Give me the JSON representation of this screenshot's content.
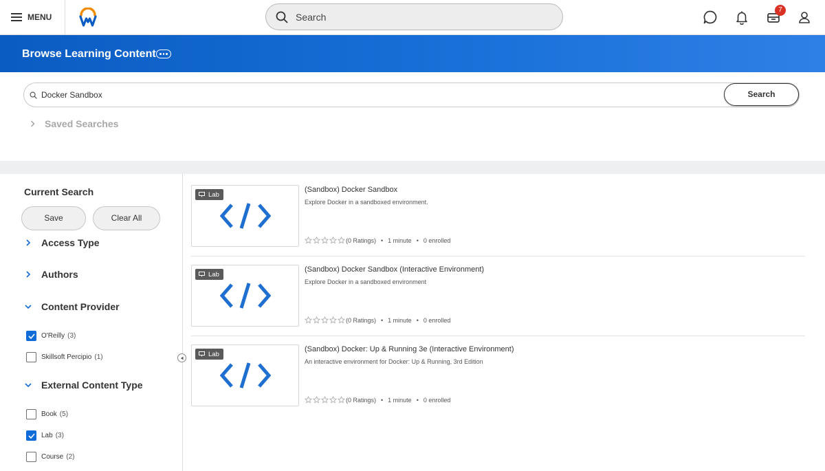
{
  "topbar": {
    "menu_label": "MENU",
    "search_placeholder": "Search",
    "inbox_badge": "7",
    "icons": [
      "hamburger-icon",
      "workday-logo",
      "search-icon",
      "chat-icon",
      "bell-icon",
      "inbox-icon",
      "user-icon"
    ]
  },
  "header": {
    "title": "Browse Learning Content"
  },
  "search": {
    "value": "Docker Sandbox",
    "button_label": "Search",
    "saved_label": "Saved Searches"
  },
  "sidebar": {
    "current_search_label": "Current Search",
    "save_label": "Save",
    "clear_label": "Clear All",
    "facets": {
      "access_type": "Access Type",
      "authors": "Authors",
      "content_provider": "Content Provider",
      "external_content_type": "External Content Type"
    },
    "provider_options": [
      {
        "label": "O'Reilly",
        "count": "(3)",
        "checked": true
      },
      {
        "label": "Skillsoft Percipio",
        "count": "(1)",
        "checked": false
      }
    ],
    "type_options": [
      {
        "label": "Book",
        "count": "(5)",
        "checked": false
      },
      {
        "label": "Lab",
        "count": "(3)",
        "checked": true
      },
      {
        "label": "Course",
        "count": "(2)",
        "checked": false
      }
    ]
  },
  "results": [
    {
      "tag": "Lab",
      "title": "(Sandbox) Docker Sandbox",
      "description": "Explore Docker in a sandboxed environment.",
      "ratings": "(0 Ratings)",
      "duration": "1 minute",
      "enrolled": "0 enrolled"
    },
    {
      "tag": "Lab",
      "title": "(Sandbox) Docker Sandbox (Interactive Environment)",
      "description": "Explore Docker in a sandboxed environment",
      "ratings": "(0 Ratings)",
      "duration": "1 minute",
      "enrolled": "0 enrolled"
    },
    {
      "tag": "Lab",
      "title": "(Sandbox) Docker: Up & Running 3e (Interactive Environment)",
      "description": "An interactive environment for Docker: Up & Running, 3rd Edition",
      "ratings": "(0 Ratings)",
      "duration": "1 minute",
      "enrolled": "0 enrolled"
    }
  ],
  "colors": {
    "brand_blue": "#0a5cc2",
    "checkbox_blue": "#0f6bd8",
    "badge_red": "#d93124",
    "code_icon_blue": "#1f6fd0"
  }
}
